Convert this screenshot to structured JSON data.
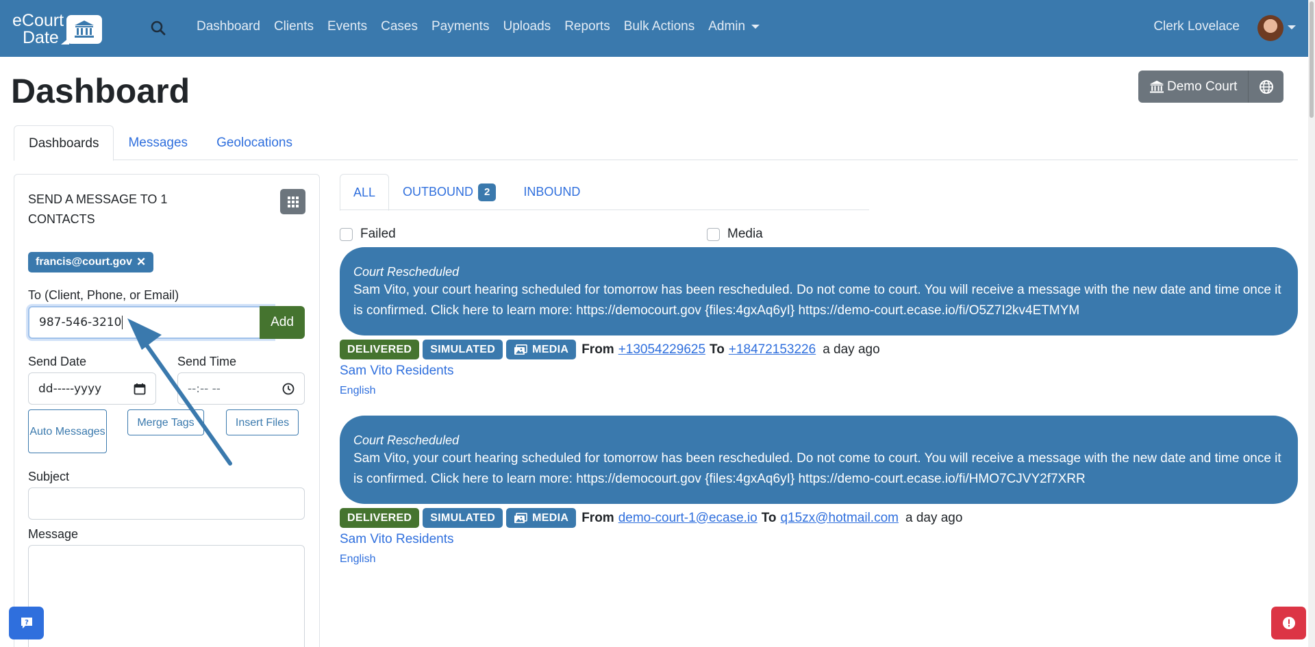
{
  "navbar": {
    "brand_line1": "eCourt",
    "brand_line2": "Date",
    "links": [
      "Dashboard",
      "Clients",
      "Events",
      "Cases",
      "Payments",
      "Uploads",
      "Reports",
      "Bulk Actions",
      "Admin"
    ],
    "user_name": "Clerk Lovelace"
  },
  "header": {
    "title": "Dashboard",
    "court_button": "Demo Court"
  },
  "tabs": [
    "Dashboards",
    "Messages",
    "Geolocations"
  ],
  "compose": {
    "title": "SEND A MESSAGE TO 1 CONTACTS",
    "chip": "francis@court.gov",
    "chip_remove": "✕",
    "to_label": "To (Client, Phone, or Email)",
    "to_value": "987-546-3210",
    "add_button": "Add",
    "send_date_label": "Send Date",
    "send_date_placeholder": "dd-----yyyy",
    "send_time_label": "Send Time",
    "send_time_placeholder": "--:-- --",
    "auto_messages": "Auto Messages",
    "merge_tags": "Merge Tags",
    "insert_files": "Insert Files",
    "subject_label": "Subject",
    "message_label": "Message"
  },
  "message_tabs": {
    "all": "ALL",
    "outbound": "OUTBOUND",
    "outbound_count": "2",
    "inbound": "INBOUND"
  },
  "filters": {
    "failed": "Failed",
    "media": "Media"
  },
  "messages": [
    {
      "title": "Court Rescheduled",
      "body": "Sam Vito, your court hearing scheduled for tomorrow has been rescheduled. Do not come to court. You will receive a message with the new date and time once it is confirmed. Click here to learn more: https://democourt.gov {files:4gxAq6yI} https://demo-court.ecase.io/fi/O5Z7I2kv4ETMYM",
      "status": "DELIVERED",
      "mode": "SIMULATED",
      "media": "MEDIA",
      "from_label": "From",
      "from": "+13054229625",
      "to_label": "To",
      "to": "+18472153226",
      "time": "a day ago",
      "group": "Sam Vito Residents",
      "language": "English"
    },
    {
      "title": "Court Rescheduled",
      "body": "Sam Vito, your court hearing scheduled for tomorrow has been rescheduled. Do not come to court. You will receive a message with the new date and time once it is confirmed. Click here to learn more: https://democourt.gov {files:4gxAq6yI} https://demo-court.ecase.io/fi/HMO7CJVY2f7XRR",
      "status": "DELIVERED",
      "mode": "SIMULATED",
      "media": "MEDIA",
      "from_label": "From",
      "from": "demo-court-1@ecase.io",
      "to_label": "To",
      "to": "q15zx@hotmail.com",
      "time": "a day ago",
      "group": "Sam Vito Residents",
      "language": "English"
    }
  ],
  "colors": {
    "primary": "#3a79ad",
    "success": "#45742f",
    "secondary": "#6c757d",
    "danger": "#dc3545",
    "link": "#2f6fdd"
  }
}
